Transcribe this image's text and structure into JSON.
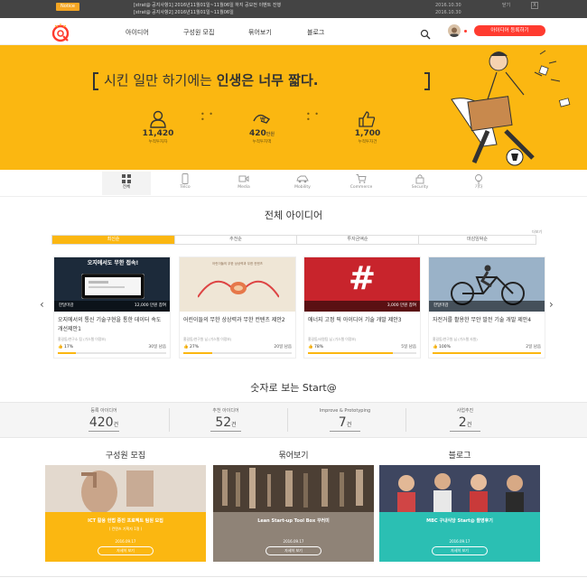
{
  "notice": {
    "badge": "Notice",
    "items": [
      {
        "text": "[strat@ 공지사항1] 2016년11월01일~11월06일 하지 공모전 이벤트 진행",
        "date": "2016.10.30"
      },
      {
        "text": "[strat@ 공지사항2] 2016년11월01일~11월06일",
        "date": "2016.10.30"
      }
    ],
    "close_label": "닫기",
    "close_x": "X"
  },
  "header": {
    "nav": [
      "아이디어",
      "구성원 모집",
      "묶어보기",
      "블로그"
    ],
    "register_button": "아이디어 등록하기"
  },
  "hero": {
    "title_normal": "시킨 일만 하기에는 ",
    "title_bold": "인생은 너무 짧다.",
    "dots": "• • •",
    "stats": [
      {
        "value": "11,420",
        "unit": "",
        "label": "누적투자자",
        "icon": "person-icon"
      },
      {
        "value": "420",
        "unit": "만원",
        "label": "누적투자액",
        "icon": "money-hand-icon"
      },
      {
        "value": "1,700",
        "unit": "",
        "label": "누적투자건",
        "icon": "thumbs-up-icon"
      }
    ]
  },
  "categories": [
    {
      "label": "전체",
      "icon": "grid-icon",
      "active": true
    },
    {
      "label": "Telco",
      "icon": "phone-icon",
      "active": false
    },
    {
      "label": "Media",
      "icon": "video-icon",
      "active": false
    },
    {
      "label": "Mobility",
      "icon": "car-icon",
      "active": false
    },
    {
      "label": "Commerce",
      "icon": "cart-icon",
      "active": false
    },
    {
      "label": "Security",
      "icon": "lock-icon",
      "active": false
    },
    {
      "label": "기타",
      "icon": "bulb-icon",
      "active": false
    }
  ],
  "ideas": {
    "title": "전체 아이디어",
    "more": "더보기",
    "sort": [
      "최신순",
      "추천순",
      "투자금액순",
      "마감임박순"
    ],
    "cards": [
      {
        "tag": "한달마감",
        "amount": "12,000 만원 참여",
        "title": "오지에서의 통신 기술구현을 통한 데이터 속도 개선제안1",
        "author": "홍길동/연구소 팀 (기스텔 이정보)",
        "pct": "17%",
        "progress": 0.17,
        "days": "30일 남음",
        "img_text": "오지에서도 무한 접속!"
      },
      {
        "tag": "",
        "amount": "",
        "title": "어린이들의 무한 상상력과 무한 컨텐츠 제안2",
        "author": "홍길동/연구원 님 (기스텔 이정보)",
        "pct": "27%",
        "progress": 0.27,
        "days": "20일 남음",
        "img_text": "어린이들의 무한 상상력과 무한 컨텐츠"
      },
      {
        "tag": "",
        "amount": "3,000 만원 참여",
        "title": "애너지 고정 픽 아이디어 기술 개발 제안3",
        "author": "홍길동/사원팀 님 (기스텔 이정보)",
        "pct": "78%",
        "progress": 0.78,
        "days": "5일 남음",
        "img_text": "#"
      },
      {
        "tag": "한달마감",
        "amount": "",
        "title": "자전거를 활용한 무안 발전 기술 개발 제안4",
        "author": "홍길동/연구원 님 (기스텔 사원)",
        "pct": "100%",
        "progress": 1.0,
        "days": "2일 남음",
        "img_text": ""
      }
    ]
  },
  "numbers": {
    "title": "숫자로 보는 Start@",
    "items": [
      {
        "label": "등록 아이디어",
        "value": "420",
        "unit": "건"
      },
      {
        "label": "추천 아이디어",
        "value": "52",
        "unit": "건"
      },
      {
        "label": "Improve & Prototyping",
        "value": "7",
        "unit": "건"
      },
      {
        "label": "사업추진",
        "value": "2",
        "unit": "건"
      }
    ]
  },
  "columns": [
    {
      "title": "구성원 모집",
      "heading": "ICT 활용 헌법 증진 프로젝트 팀원 모집",
      "sub": "( 컨텐츠 기획자 1명 )",
      "date": "2016.09.17",
      "button": "자세히 보기",
      "color": "#fbb711"
    },
    {
      "title": "묶어보기",
      "heading": "Lean Start-up Tool Box 꾸러미",
      "sub": "",
      "date": "2016.09.17",
      "button": "자세히 보기",
      "color": "#8f8377"
    },
    {
      "title": "블로그",
      "heading": "MBC 구내식당 Start@ 촬영후기",
      "sub": "",
      "date": "2016.09.17",
      "button": "자세히 보기",
      "color": "#2bbfb3"
    }
  ]
}
